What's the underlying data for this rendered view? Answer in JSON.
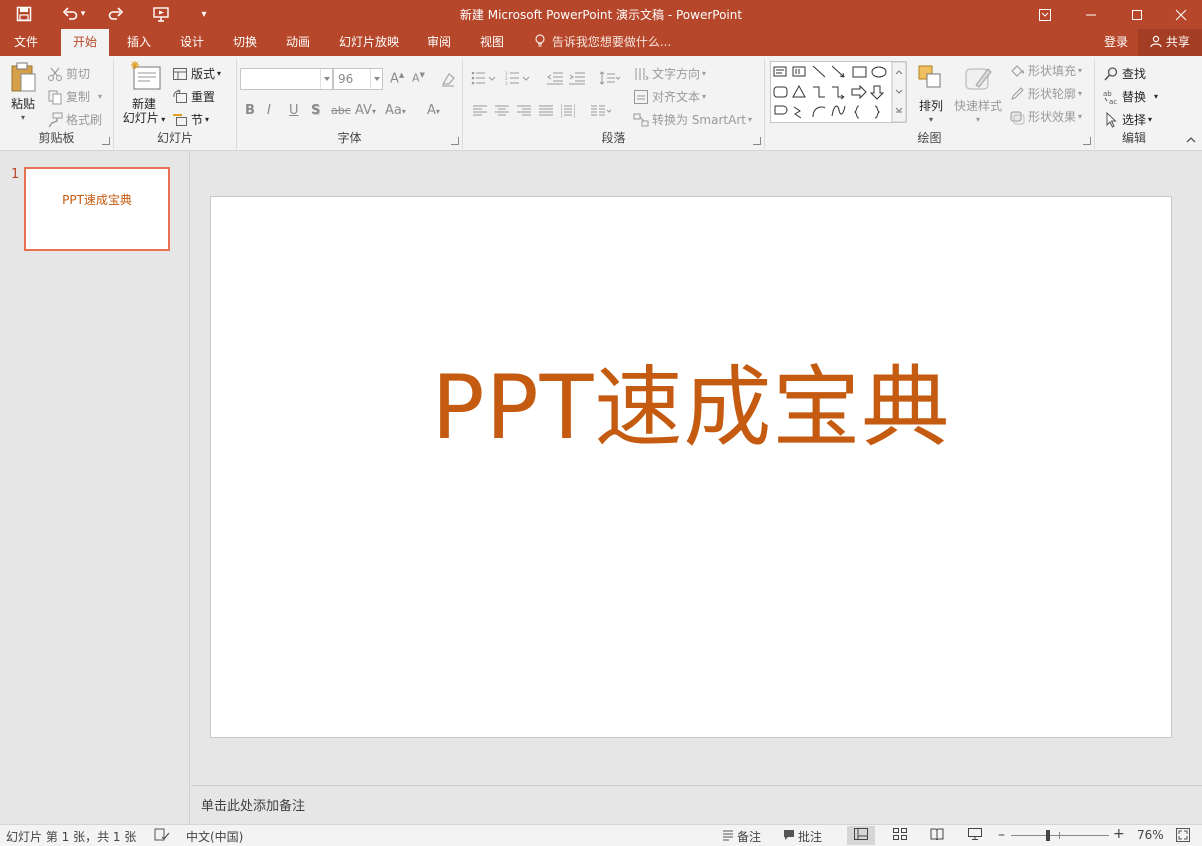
{
  "titlebar": {
    "title": "新建 Microsoft PowerPoint 演示文稿 - PowerPoint"
  },
  "tabs": [
    {
      "label": "文件"
    },
    {
      "label": "开始"
    },
    {
      "label": "插入"
    },
    {
      "label": "设计"
    },
    {
      "label": "切换"
    },
    {
      "label": "动画"
    },
    {
      "label": "幻灯片放映"
    },
    {
      "label": "审阅"
    },
    {
      "label": "视图"
    }
  ],
  "tell_me": "告诉我您想要做什么...",
  "account": {
    "login": "登录",
    "share": "共享"
  },
  "ribbon": {
    "clipboard": {
      "paste": "粘贴",
      "cut": "剪切",
      "copy": "复制",
      "painter": "格式刷",
      "label": "剪贴板"
    },
    "slides": {
      "new_slide_1": "新建",
      "new_slide_2": "幻灯片",
      "layout": "版式",
      "reset": "重置",
      "section": "节",
      "label": "幻灯片"
    },
    "font": {
      "font_name": "",
      "font_size": "96",
      "label": "字体"
    },
    "paragraph": {
      "text_direction": "文字方向",
      "align_text": "对齐文本",
      "smartart": "转换为 SmartArt",
      "label": "段落"
    },
    "drawing": {
      "arrange": "排列",
      "quick_styles": "快速样式",
      "shape_fill": "形状填充",
      "shape_outline": "形状轮廓",
      "shape_effects": "形状效果",
      "label": "绘图"
    },
    "editing": {
      "find": "查找",
      "replace": "替换",
      "select": "选择",
      "label": "编辑"
    }
  },
  "thumbnail": {
    "number": "1",
    "text": "PPT速成宝典"
  },
  "slide": {
    "title": "PPT速成宝典"
  },
  "notes": {
    "placeholder": "单击此处添加备注"
  },
  "status": {
    "slide_info": "幻灯片 第 1 张，共 1 张",
    "language": "中文(中国)",
    "notes_btn": "备注",
    "comments_btn": "批注",
    "zoom": "76%",
    "zoom_fraction": 0.38
  },
  "colors": {
    "accent": "#b7472a",
    "title_text": "#c55a11",
    "thumb_border": "#e8724f"
  }
}
